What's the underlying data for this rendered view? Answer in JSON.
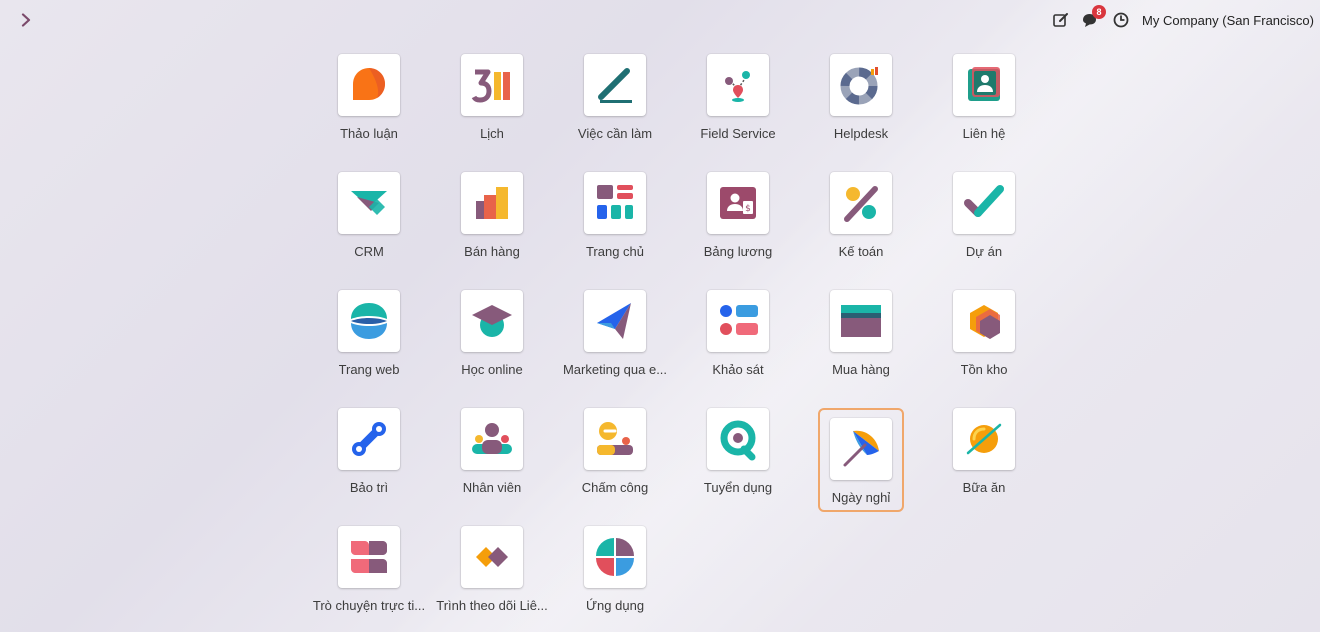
{
  "topbar": {
    "company": "My Company (San Francisco)",
    "messages_badge": "8",
    "icons": [
      "chevron-right-icon",
      "edit-note-icon",
      "chat-bubbles-icon",
      "clock-icon"
    ]
  },
  "apps": [
    {
      "label": "Thảo luận",
      "icon": "discuss-icon"
    },
    {
      "label": "Lịch",
      "icon": "calendar-icon"
    },
    {
      "label": "Việc cần làm",
      "icon": "todo-icon"
    },
    {
      "label": "Field Service",
      "icon": "field-service-icon"
    },
    {
      "label": "Helpdesk",
      "icon": "helpdesk-icon"
    },
    {
      "label": "Liên hệ",
      "icon": "contacts-icon"
    },
    {
      "label": "CRM",
      "icon": "crm-icon"
    },
    {
      "label": "Bán hàng",
      "icon": "sales-icon"
    },
    {
      "label": "Trang chủ",
      "icon": "dashboard-icon"
    },
    {
      "label": "Bảng lương",
      "icon": "payroll-icon"
    },
    {
      "label": "Kế toán",
      "icon": "accounting-icon"
    },
    {
      "label": "Dự án",
      "icon": "project-icon"
    },
    {
      "label": "Trang web",
      "icon": "website-icon"
    },
    {
      "label": "Học online",
      "icon": "elearning-icon"
    },
    {
      "label": "Marketing qua e...",
      "icon": "email-marketing-icon"
    },
    {
      "label": "Khảo sát",
      "icon": "survey-icon"
    },
    {
      "label": "Mua hàng",
      "icon": "purchase-icon"
    },
    {
      "label": "Tồn kho",
      "icon": "inventory-icon"
    },
    {
      "label": "Bảo trì",
      "icon": "maintenance-icon"
    },
    {
      "label": "Nhân viên",
      "icon": "employees-icon"
    },
    {
      "label": "Chấm công",
      "icon": "attendance-icon"
    },
    {
      "label": "Tuyển dụng",
      "icon": "recruitment-icon"
    },
    {
      "label": "Ngày nghỉ",
      "icon": "time-off-icon",
      "active": true
    },
    {
      "label": "Bữa ăn",
      "icon": "lunch-icon"
    },
    {
      "label": "Trò chuyện trực ti...",
      "icon": "live-chat-icon"
    },
    {
      "label": "Trình theo dõi Liê...",
      "icon": "link-tracker-icon"
    },
    {
      "label": "Ứng dụng",
      "icon": "apps-icon"
    }
  ],
  "colors": {
    "accent_border": "#f0a76b",
    "badge": "#d9363e",
    "odoo_purple": "#875a7b"
  }
}
